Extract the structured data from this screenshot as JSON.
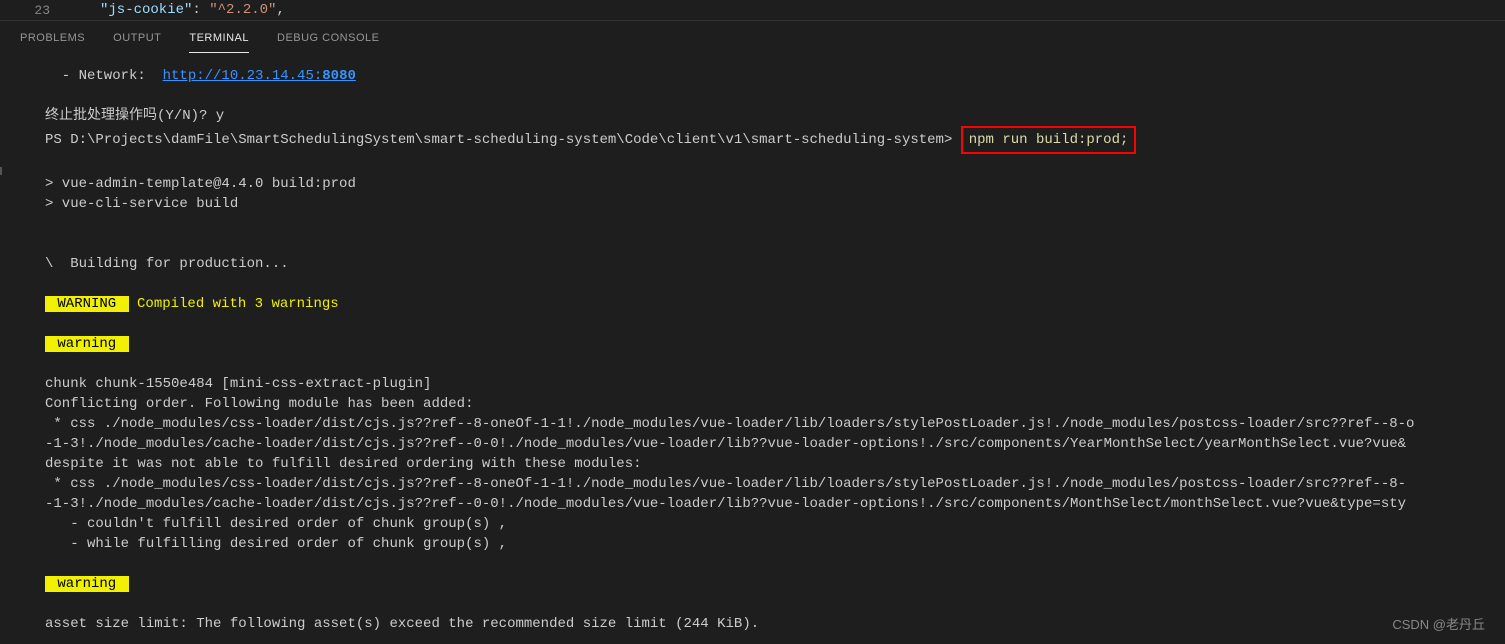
{
  "editor": {
    "lineNumber": "23",
    "jsonKey": "\"js-cookie\"",
    "colon": ": ",
    "jsonValue": "\"^2.2.0\"",
    "comma": ","
  },
  "tabs": {
    "problems": "PROBLEMS",
    "output": "OUTPUT",
    "terminal": "TERMINAL",
    "debugConsole": "DEBUG CONSOLE"
  },
  "terminal": {
    "networkLabel": "  - Network:  ",
    "networkUrlBase": "http://10.23.14.45:",
    "networkPort": "8080",
    "promptLine1": "终止批处理操作吗(Y/N)? y",
    "psPrompt": "PS D:\\Projects\\damFile\\SmartSchedulingSystem\\smart-scheduling-system\\Code\\client\\v1\\smart-scheduling-system> ",
    "command": "npm run build:prod;",
    "buildLine1": "> vue-admin-template@4.4.0 build:prod",
    "buildLine2": "> vue-cli-service build",
    "buildingLine": "\\  Building for production...",
    "warningBadge": " WARNING ",
    "compiledText": " Compiled with 3 warnings",
    "warningLabel": " warning ",
    "chunk1": "chunk chunk-1550e484 [mini-css-extract-plugin]",
    "conflicting": "Conflicting order. Following module has been added:",
    "cssLine1": " * css ./node_modules/css-loader/dist/cjs.js??ref--8-oneOf-1-1!./node_modules/vue-loader/lib/loaders/stylePostLoader.js!./node_modules/postcss-loader/src??ref--8-o",
    "cssLine2": "-1-3!./node_modules/cache-loader/dist/cjs.js??ref--0-0!./node_modules/vue-loader/lib??vue-loader-options!./src/components/YearMonthSelect/yearMonthSelect.vue?vue&",
    "despite": "despite it was not able to fulfill desired ordering with these modules:",
    "cssLine3": " * css ./node_modules/css-loader/dist/cjs.js??ref--8-oneOf-1-1!./node_modules/vue-loader/lib/loaders/stylePostLoader.js!./node_modules/postcss-loader/src??ref--8-",
    "cssLine4": "-1-3!./node_modules/cache-loader/dist/cjs.js??ref--0-0!./node_modules/vue-loader/lib??vue-loader-options!./src/components/MonthSelect/monthSelect.vue?vue&type=sty",
    "couldnt": "   - couldn't fulfill desired order of chunk group(s) ,",
    "while": "   - while fulfilling desired order of chunk group(s) ,",
    "assetSize": "asset size limit: The following asset(s) exceed the recommended size limit (244 KiB)."
  },
  "watermark": "CSDN @老丹丘"
}
